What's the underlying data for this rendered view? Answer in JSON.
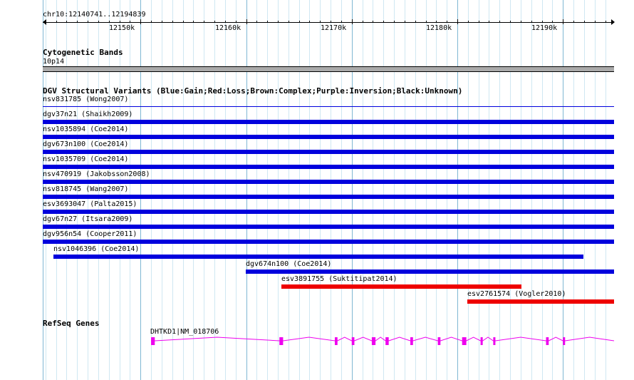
{
  "ruler": {
    "locus": "chr10:12140741..12194839",
    "ticks": [
      "12150k",
      "12160k",
      "12170k",
      "12180k",
      "12190k"
    ]
  },
  "cytoband_track": {
    "title": "Cytogenetic Bands",
    "band": "10p14"
  },
  "dgv_track": {
    "title": "DGV Structural Variants (Blue:Gain;Red:Loss;Brown:Complex;Purple:Inversion;Black:Unknown)",
    "colors": {
      "gain": "#0000dd",
      "loss": "#ee0000"
    },
    "features": [
      {
        "name": "nsv831785 (Wong2007)",
        "start": 12140741,
        "end": 12194839,
        "type": "gain",
        "style": "thin"
      },
      {
        "name": "dgv37n21 (Shaikh2009)",
        "start": 12140741,
        "end": 12194839,
        "type": "gain",
        "style": "thick"
      },
      {
        "name": "nsv1035894 (Coe2014)",
        "start": 12140741,
        "end": 12194839,
        "type": "gain",
        "style": "thick"
      },
      {
        "name": "dgv673n100 (Coe2014)",
        "start": 12140741,
        "end": 12194839,
        "type": "gain",
        "style": "thick"
      },
      {
        "name": "nsv1035709 (Coe2014)",
        "start": 12140741,
        "end": 12194839,
        "type": "gain",
        "style": "thick"
      },
      {
        "name": "nsv470919 (Jakobsson2008)",
        "start": 12140741,
        "end": 12194839,
        "type": "gain",
        "style": "thick"
      },
      {
        "name": "nsv818745 (Wang2007)",
        "start": 12140741,
        "end": 12194839,
        "type": "gain",
        "style": "thick"
      },
      {
        "name": "esv3693047 (Palta2015)",
        "start": 12140741,
        "end": 12194839,
        "type": "gain",
        "style": "thick"
      },
      {
        "name": "dgv67n27 (Itsara2009)",
        "start": 12140741,
        "end": 12194839,
        "type": "gain",
        "style": "thick"
      },
      {
        "name": "dgv956n54 (Cooper2011)",
        "start": 12140741,
        "end": 12194839,
        "type": "gain",
        "style": "thick"
      },
      {
        "name": "nsv1046396 (Coe2014)",
        "start": 12141750,
        "end": 12191950,
        "type": "gain",
        "style": "thick"
      },
      {
        "name": "dgv674n100 (Coe2014)",
        "start": 12159970,
        "end": 12194839,
        "type": "gain",
        "style": "thick"
      },
      {
        "name": "esv3891755 (Suktitipat2014)",
        "start": 12163350,
        "end": 12186100,
        "type": "loss",
        "style": "thick"
      },
      {
        "name": "esv2761574 (Vogler2010)",
        "start": 12180950,
        "end": 12194839,
        "type": "loss",
        "style": "thick"
      }
    ]
  },
  "refseq_track": {
    "title": "RefSeq Genes",
    "gene_label": "DHTKD1|NM_018706",
    "color": "#ee00ee",
    "start": 12151000,
    "end": 12194839,
    "exons": [
      [
        12151000,
        12151350
      ],
      [
        12163150,
        12163500
      ],
      [
        12168400,
        12168650
      ],
      [
        12170000,
        12170250
      ],
      [
        12171900,
        12172250
      ],
      [
        12173200,
        12173500
      ],
      [
        12175550,
        12175800
      ],
      [
        12178150,
        12178400
      ],
      [
        12180450,
        12180850
      ],
      [
        12182200,
        12182400
      ],
      [
        12183400,
        12183600
      ],
      [
        12188400,
        12188650
      ],
      [
        12190000,
        12190200
      ]
    ]
  }
}
